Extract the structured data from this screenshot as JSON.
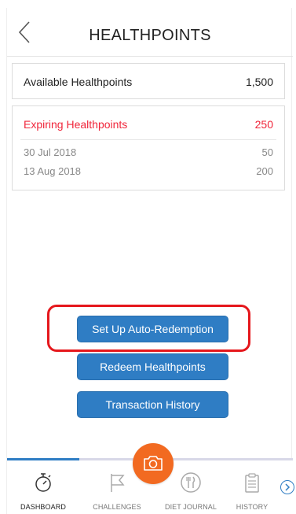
{
  "header": {
    "title": "HEALTHPOINTS"
  },
  "available": {
    "label": "Available Healthpoints",
    "value": "1,500"
  },
  "expiring": {
    "label": "Expiring Healthpoints",
    "total": "250",
    "items": [
      {
        "date": "30 Jul 2018",
        "points": "50"
      },
      {
        "date": "13 Aug 2018",
        "points": "200"
      }
    ]
  },
  "actions": {
    "auto_redemption": "Set Up Auto-Redemption",
    "redeem": "Redeem Healthpoints",
    "history": "Transaction History"
  },
  "tabs": [
    {
      "label": "DASHBOARD",
      "icon": "stopwatch-icon"
    },
    {
      "label": "CHALLENGES",
      "icon": "flag-icon"
    },
    {
      "label": "DIET JOURNAL",
      "icon": "fork-knife-icon"
    },
    {
      "label": "HISTORY",
      "icon": "clipboard-icon"
    }
  ],
  "colors": {
    "accent": "#2f7dc4",
    "expiring": "#f0253a",
    "camera": "#f26a21",
    "highlight": "#e5171c"
  }
}
